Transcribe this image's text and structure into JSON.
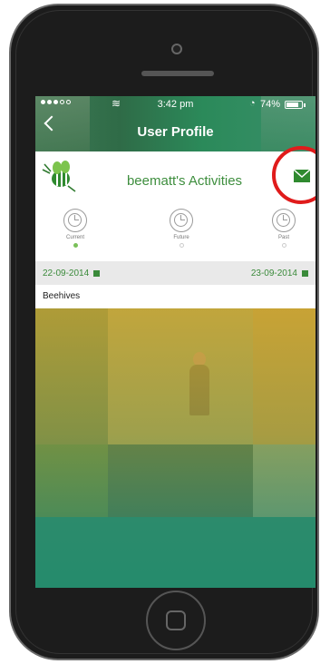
{
  "status_bar": {
    "time": "3:42 pm",
    "battery": "74%"
  },
  "header": {
    "title": "User Profile"
  },
  "activities": {
    "title": "beematt's Activities",
    "tabs": [
      {
        "label": "Current",
        "active": true
      },
      {
        "label": "Future",
        "active": false
      },
      {
        "label": "Past",
        "active": false
      }
    ]
  },
  "date_range": {
    "start": "22-09-2014",
    "end": "23-09-2014"
  },
  "activity": {
    "name": "Beehives"
  },
  "colors": {
    "accent": "#3e8e3e",
    "highlight": "#e01b1b"
  }
}
